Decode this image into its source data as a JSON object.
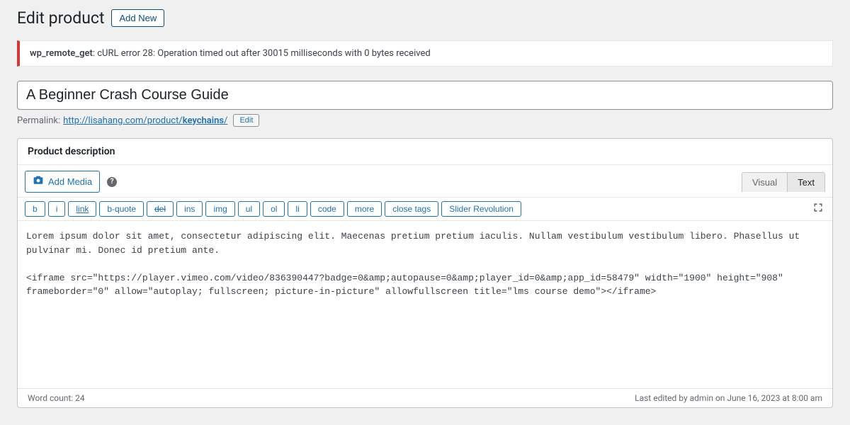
{
  "header": {
    "title": "Edit product",
    "add_new_label": "Add New"
  },
  "notice": {
    "strong": "wp_remote_get",
    "text": ": cURL error 28: Operation timed out after 30015 milliseconds with 0 bytes received"
  },
  "product": {
    "title": "A Beginner Crash Course Guide"
  },
  "permalink": {
    "label": "Permalink:",
    "base": "http://lisahang.com/product/",
    "slug": "keychains",
    "trail": "/",
    "edit_label": "Edit"
  },
  "editor": {
    "box_title": "Product description",
    "add_media_label": "Add Media",
    "tabs": {
      "visual": "Visual",
      "text": "Text"
    },
    "quicktags": {
      "b": "b",
      "i": "i",
      "link": "link",
      "bquote": "b-quote",
      "del": "del",
      "ins": "ins",
      "img": "img",
      "ul": "ul",
      "ol": "ol",
      "li": "li",
      "code": "code",
      "more": "more",
      "close": "close tags",
      "slider": "Slider Revolution"
    },
    "content": "Lorem ipsum dolor sit amet, consectetur adipiscing elit. Maecenas pretium pretium iaculis. Nullam vestibulum vestibulum libero. Phasellus ut pulvinar mi. Donec id pretium ante.\n\n<iframe src=\"https://player.vimeo.com/video/836390447?badge=0&amp;autopause=0&amp;player_id=0&amp;app_id=58479\" width=\"1900\" height=\"908\" frameborder=\"0\" allow=\"autoplay; fullscreen; picture-in-picture\" allowfullscreen title=\"lms course demo\"></iframe>"
  },
  "status": {
    "word_count": "Word count: 24",
    "last_edited": "Last edited by admin on June 16, 2023 at 8:00 am"
  }
}
